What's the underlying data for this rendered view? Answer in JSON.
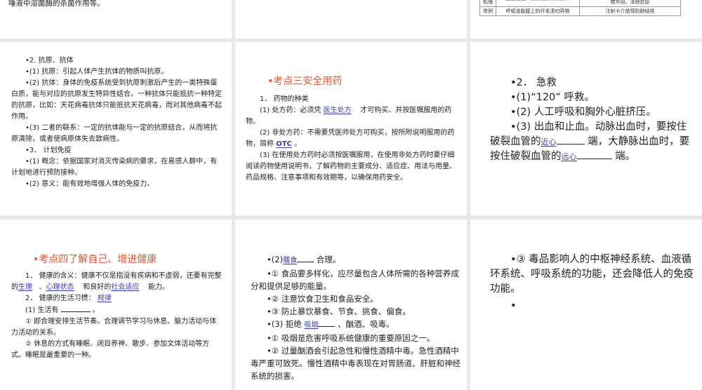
{
  "slides": [
    {
      "id": "s1",
      "text": "唾液中溶菌酶的杀菌作用等。"
    },
    {
      "id": "s2"
    },
    {
      "id": "s3",
      "table": {
        "rows": [
          [
            "作用机理",
            "直接阻挡、清除或杀死病原体",
            "产生抗体，与抗原结合，促进吞噬细胞的吞噬作用，清除抗原"
          ],
          [
            "举例",
            "呼吸道黏膜上的纤毛清扫异物",
            "注射卡介苗预防肺结核"
          ]
        ]
      }
    },
    {
      "id": "s4",
      "lines": [
        "•2. 抗原、抗体",
        "•(1) 抗原：引起人体产生抗体的物质叫抗原。",
        "•(2) 抗体：身体的免疫系统受到抗原刺激后产生的一类特殊蛋白质，能与对应的抗原发生特异性结合。一种抗体只能抵抗一种特定的抗原，比如：天花病毒抗体只能抵抗天花病毒，而对其他病毒不起作用。",
        "•(3) 二者的联系：一定的抗体能与一定的抗原结合，从而将抗原清除，或者使病原体失去致病性。",
        "•3． 计划免疫",
        "•(1) 概念：依据国家对消灭传染病的要求，在易感人群中，有计划地进行预防接种。",
        "•(2) 意义：能有效地增强人体的免疫力。"
      ]
    },
    {
      "id": "s5",
      "title": "•考点三安全用药",
      "l1": "1． 药物的种类",
      "l2a": "(1) 处方药：必须凭",
      "l2ans": "医生处方",
      "l2b": "才可购买、并按医嘱服用的药物。",
      "l3a": "(2) 非处方药：不需要凭医师处方可购买，按所附说明服用的药物，简称",
      "l3ans": "OTC",
      "l3b": "。",
      "l4": "(3) 在使用处方药时必须按医嘱服用，在使用非处方药时要仔细阅读药物使用说明书，了解药物的主要成分、适应症、用法与用量、药品规格、注意事项和有效期等，以确保用药安全。"
    },
    {
      "id": "s6",
      "l1": "•2． 急救",
      "l2": "•(1)“120” 呼救。",
      "l3": "•(2) 人工呼吸和胸外心脏挤压。",
      "l4a": "•(3) 出血和止血。动脉出血时，要按住破裂血管的",
      "ans1": "近心",
      "l4b": "端，大静脉出血时，要按住破裂血管的",
      "ans2": "远心",
      "l4c": "端。"
    },
    {
      "id": "s7",
      "title": "•考点四了解自己、增进健康",
      "l1a": "1． 健康的含义：健康不仅是指没有疾病和不虚弱，还要有完整的",
      "ans1": "生理",
      "sep1": "、",
      "ans2": "心理状态",
      "l1b": "和良好的",
      "ans3": "社会适应",
      "l1c": "能力。",
      "l2a": "2． 健康的生活习惯：",
      "ans4": "规律",
      "l3a": "(1) 生活有",
      "l3b": "。",
      "l4": "① 即合理安排生活节奏。合理调节学习与休息、脑力活动与体力活动的关系。",
      "l5": "② 休息的方式有睡眠、闭目养神、散步、参加文体活动等方式。睡眠是最重要的一种。"
    },
    {
      "id": "s8",
      "l1a": "•(2)",
      "ans1": "膳食",
      "l1b": "合理。",
      "l2": "•① 食品要多样化，应尽量包含人体所需的各种营养成分和提供足够的能量。",
      "l3": "•② 注意饮食卫生和食品安全。",
      "l4": "•③ 防止暴饮暴食、节食、挑食、偏食。",
      "l5a": "•(3) 拒绝",
      "ans2": "吸烟",
      "l5b": "、酗酒、吸毒。",
      "l6": "•① 吸烟是危害呼吸系统健康的重要原因之一。",
      "l7": "•② 过量酗酒会引起急性和慢性酒精中毒。急性酒精中毒严重可致死。慢性酒精中毒表现在对胃肠道、肝脏和神经系统的损害。"
    },
    {
      "id": "s9",
      "l1": "•③ 毒品影响人的中枢神经系统、血液循环系统、呼吸系统的功能，还会降低人的免疫功能。",
      "l2": "•"
    }
  ]
}
